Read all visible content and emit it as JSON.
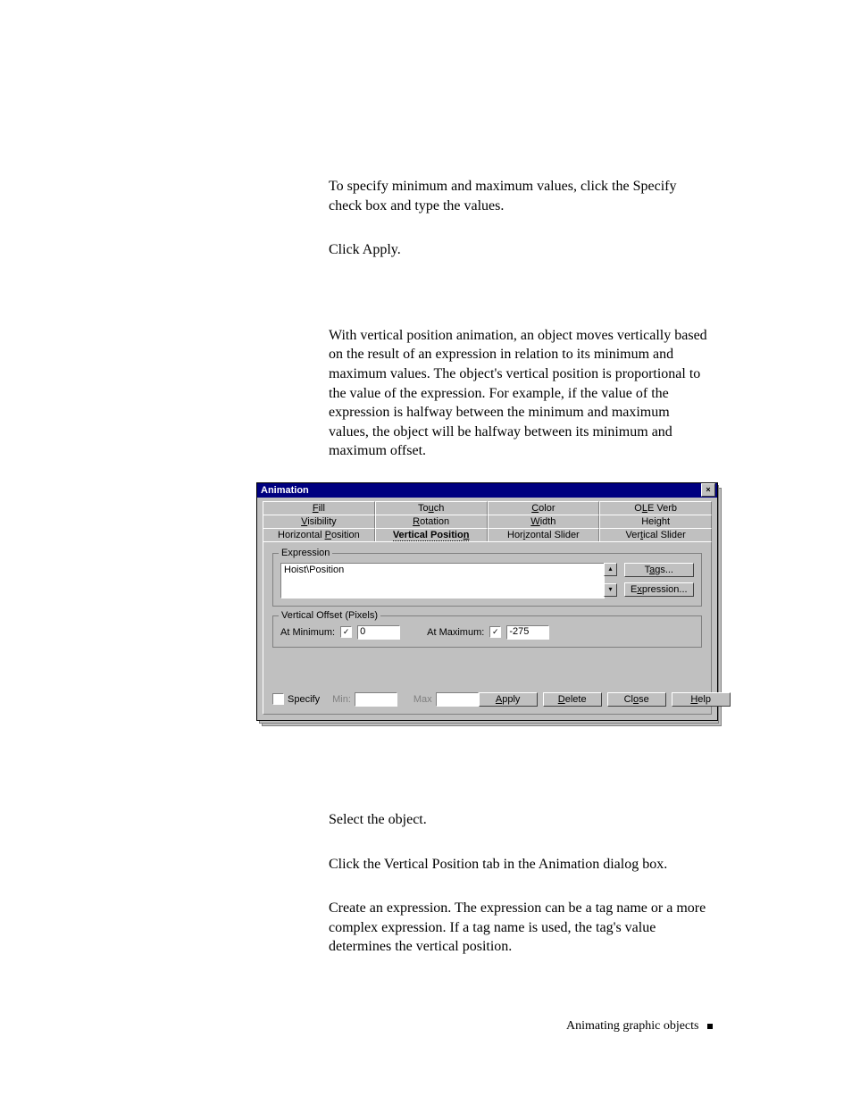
{
  "body": {
    "p1": "To specify minimum and maximum values, click the Specify check box and type the values.",
    "p2": "Click Apply.",
    "p3": "With vertical position animation, an object moves vertically based on the result of an expression in relation to its minimum and maximum values. The object's vertical position is proportional to the value of the expression. For example, if the value of the expression is halfway between the minimum and maximum values, the object will be halfway between its minimum and maximum offset.",
    "p4": "Select the object.",
    "p5": "Click the Vertical Position tab in the Animation dialog box.",
    "p6": "Create an expression. The expression can be a tag name or a more complex expression. If a tag name is used, the tag's value determines the vertical position."
  },
  "dialog": {
    "title": "Animation",
    "tabs_row1": [
      "Fill",
      "Touch",
      "Color",
      "OLE Verb"
    ],
    "tabs_row2": [
      "Visibility",
      "Rotation",
      "Width",
      "Height"
    ],
    "tabs_row3": [
      "Horizontal Position",
      "Vertical Position",
      "Horizontal Slider",
      "Vertical Slider"
    ],
    "active_tab": "Vertical Position",
    "expression_group": "Expression",
    "expression_value": "Hoist\\Position",
    "tags_btn": "Tags...",
    "expr_btn": "Expression...",
    "offset_group": "Vertical Offset (Pixels)",
    "at_min_label": "At Minimum:",
    "at_min_checked": true,
    "at_min_value": "0",
    "at_max_label": "At Maximum:",
    "at_max_checked": true,
    "at_max_value": "-275",
    "specify_label": "Specify",
    "specify_checked": false,
    "min_label": "Min:",
    "max_label": "Max",
    "btn_apply": "Apply",
    "btn_delete": "Delete",
    "btn_close": "Close",
    "btn_help": "Help"
  },
  "footer": {
    "text": "Animating graphic objects"
  }
}
